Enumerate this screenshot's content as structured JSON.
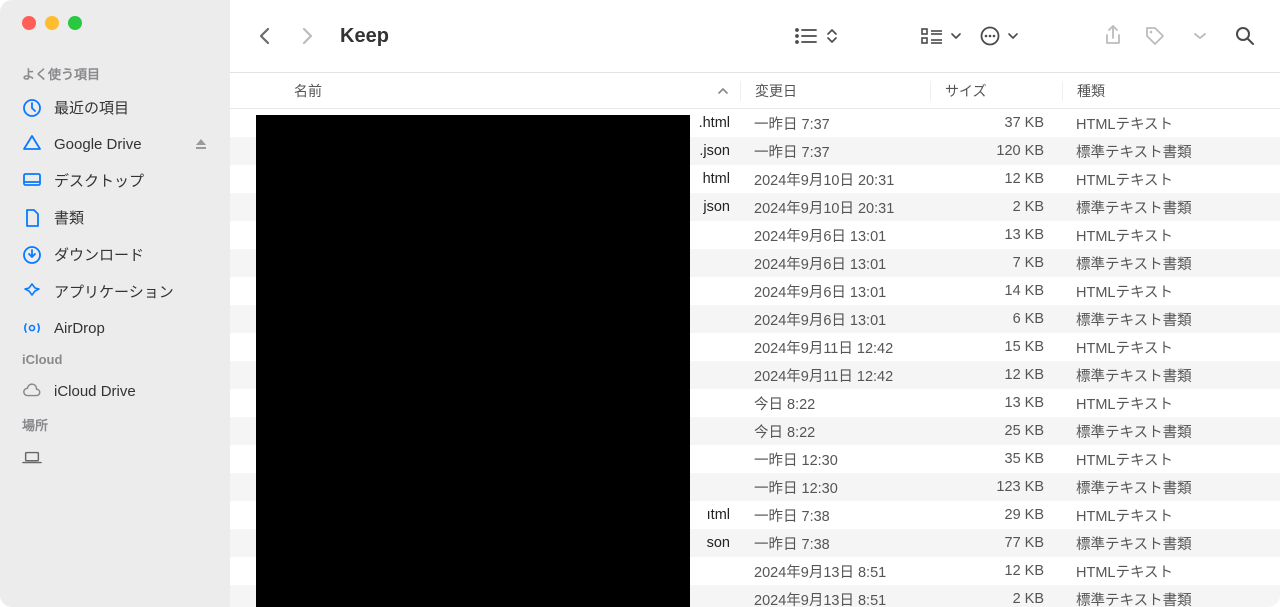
{
  "window": {
    "title": "Keep"
  },
  "sidebar": {
    "sections": [
      {
        "heading": "よく使う項目",
        "items": [
          {
            "icon": "clock-icon",
            "label": "最近の項目"
          },
          {
            "icon": "google-drive-icon",
            "label": "Google Drive",
            "eject": true
          },
          {
            "icon": "desktop-icon",
            "label": "デスクトップ"
          },
          {
            "icon": "document-icon",
            "label": "書類"
          },
          {
            "icon": "download-icon",
            "label": "ダウンロード"
          },
          {
            "icon": "grid-icon",
            "label": "アプリケーション"
          },
          {
            "icon": "airdrop-icon",
            "label": "AirDrop"
          }
        ]
      },
      {
        "heading": "iCloud",
        "items": [
          {
            "icon": "cloud-icon",
            "label": "iCloud Drive"
          }
        ]
      },
      {
        "heading": "場所",
        "items": [
          {
            "icon": "laptop-icon",
            "label": ""
          }
        ]
      }
    ]
  },
  "columns": {
    "name": "名前",
    "date": "変更日",
    "size": "サイズ",
    "kind": "種類"
  },
  "files": [
    {
      "name": ".html",
      "date": "一昨日 7:37",
      "size": "37 KB",
      "kind": "HTMLテキスト"
    },
    {
      "name": ".json",
      "date": "一昨日 7:37",
      "size": "120 KB",
      "kind": "標準テキスト書類"
    },
    {
      "name": "html",
      "date": "2024年9月10日 20:31",
      "size": "12 KB",
      "kind": "HTMLテキスト"
    },
    {
      "name": "json",
      "date": "2024年9月10日 20:31",
      "size": "2 KB",
      "kind": "標準テキスト書類"
    },
    {
      "name": "",
      "date": "2024年9月6日 13:01",
      "size": "13 KB",
      "kind": "HTMLテキスト"
    },
    {
      "name": "",
      "date": "2024年9月6日 13:01",
      "size": "7 KB",
      "kind": "標準テキスト書類"
    },
    {
      "name": "",
      "date": "2024年9月6日 13:01",
      "size": "14 KB",
      "kind": "HTMLテキスト"
    },
    {
      "name": "",
      "date": "2024年9月6日 13:01",
      "size": "6 KB",
      "kind": "標準テキスト書類"
    },
    {
      "name": "",
      "date": "2024年9月11日 12:42",
      "size": "15 KB",
      "kind": "HTMLテキスト"
    },
    {
      "name": "",
      "date": "2024年9月11日 12:42",
      "size": "12 KB",
      "kind": "標準テキスト書類"
    },
    {
      "name": "",
      "date": "今日 8:22",
      "size": "13 KB",
      "kind": "HTMLテキスト"
    },
    {
      "name": "",
      "date": "今日 8:22",
      "size": "25 KB",
      "kind": "標準テキスト書類"
    },
    {
      "name": "",
      "date": "一昨日 12:30",
      "size": "35 KB",
      "kind": "HTMLテキスト"
    },
    {
      "name": "",
      "date": "一昨日 12:30",
      "size": "123 KB",
      "kind": "標準テキスト書類"
    },
    {
      "name": "ıtml",
      "date": "一昨日 7:38",
      "size": "29 KB",
      "kind": "HTMLテキスト"
    },
    {
      "name": "son",
      "date": "一昨日 7:38",
      "size": "77 KB",
      "kind": "標準テキスト書類"
    },
    {
      "name": "",
      "date": "2024年9月13日 8:51",
      "size": "12 KB",
      "kind": "HTMLテキスト"
    },
    {
      "name": "",
      "date": "2024年9月13日 8:51",
      "size": "2 KB",
      "kind": "標準テキスト書類"
    }
  ]
}
